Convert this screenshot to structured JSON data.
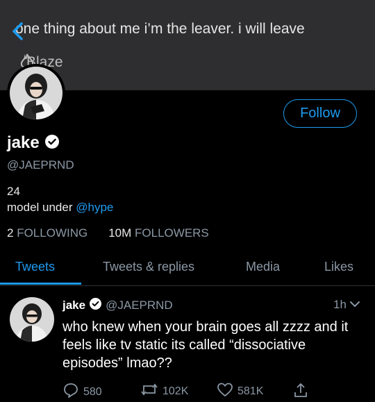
{
  "banner": {
    "quote": "one thing about me i’m the leaver. i will leave",
    "author": "Blaze"
  },
  "profile": {
    "follow_label": "Follow",
    "name": "jake",
    "handle": "@JAEPRND",
    "bio_line1": "24",
    "bio_prefix": "model under ",
    "bio_mention": "@hype",
    "following_count": "2",
    "following_label": "FOLLOWING",
    "followers_count": "10M",
    "followers_label": "FOLLOWERS"
  },
  "tabs": [
    {
      "label": "Tweets",
      "active": true
    },
    {
      "label": "Tweets & replies",
      "active": false
    },
    {
      "label": "Media",
      "active": false
    },
    {
      "label": "Likes",
      "active": false
    }
  ],
  "tweet": {
    "name": "jake",
    "handle": "@JAEPRND",
    "time": "1h",
    "text": "who knew when your brain goes all zzzz and it feels like tv static its called “dissociative episodes” lmao??",
    "replies": "580",
    "retweets": "102K",
    "likes": "581K"
  },
  "colors": {
    "accent": "#1d9bf0",
    "muted": "#8b98a5",
    "background": "#000000",
    "banner": "#2e2e30"
  },
  "icons": [
    "back-chevron-icon",
    "flame-icon",
    "verified-badge-icon",
    "chevron-down-icon",
    "reply-icon",
    "retweet-icon",
    "like-icon",
    "share-icon"
  ]
}
